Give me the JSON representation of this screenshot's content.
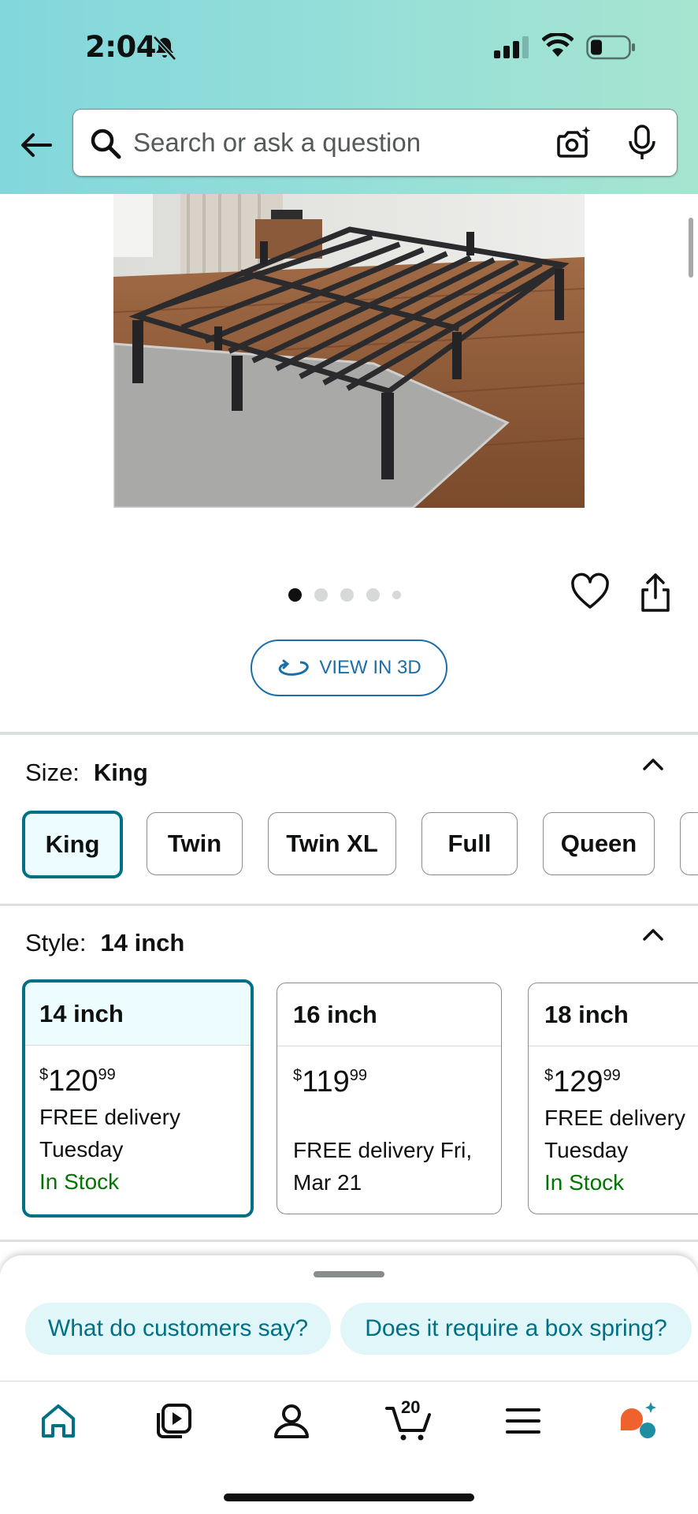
{
  "status_bar": {
    "time": "2:04",
    "icons": [
      "bell-muted-icon",
      "cellular-signal-icon",
      "wifi-icon",
      "battery-icon"
    ]
  },
  "header": {
    "back_icon": "arrow-left-icon",
    "search": {
      "placeholder": "Search or ask a question",
      "value": "",
      "camera_icon": "camera-lens-icon",
      "mic_icon": "microphone-icon"
    }
  },
  "product": {
    "image_alt": "metal bed frame",
    "carousel": {
      "total_dots": 5,
      "active_index": 0
    },
    "wishlist_icon": "heart-icon",
    "share_icon": "share-icon",
    "view_3d_label": "VIEW IN 3D"
  },
  "size": {
    "label": "Size:",
    "selected": "King",
    "options": [
      "King",
      "Twin",
      "Twin XL",
      "Full",
      "Queen"
    ]
  },
  "style": {
    "label": "Style:",
    "selected": "14 inch",
    "options": [
      {
        "name": "14 inch",
        "price_symbol": "$",
        "price_whole": "120",
        "price_fraction": "99",
        "delivery_line1": "FREE delivery",
        "delivery_line2": "Tuesday",
        "stock": "In Stock"
      },
      {
        "name": "16 inch",
        "price_symbol": "$",
        "price_whole": "119",
        "price_fraction": "99",
        "delivery_line1": "FREE delivery Fri,",
        "delivery_line2": "Mar 21",
        "stock": ""
      },
      {
        "name": "18 inch",
        "price_symbol": "$",
        "price_whole": "129",
        "price_fraction": "99",
        "delivery_line1": "FREE delivery",
        "delivery_line2": "Tuesday",
        "stock": "In Stock"
      }
    ]
  },
  "suggestions": [
    "What do customers say?",
    "Does it require a box spring?"
  ],
  "bottom_nav": {
    "items": [
      "home-icon",
      "video-icon",
      "account-icon",
      "cart-icon",
      "menu-icon",
      "rufus-assistant-icon"
    ],
    "cart_count": "20"
  },
  "colors": {
    "accent_teal": "#007185",
    "link_blue": "#1a6fa8",
    "in_stock_green": "#007600",
    "header_gradient_start": "#82d7dc",
    "header_gradient_end": "#a6e5cf"
  }
}
